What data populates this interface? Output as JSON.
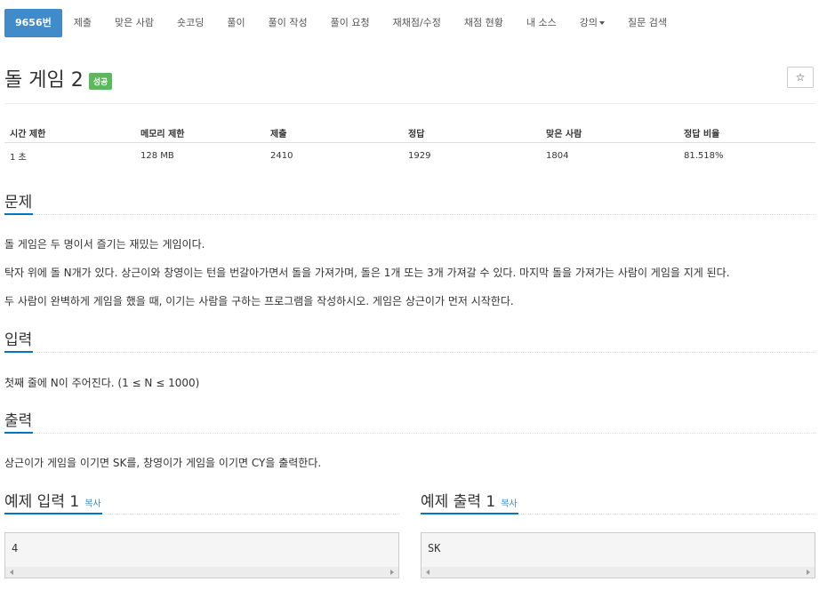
{
  "nav": {
    "items": [
      "9656번",
      "제출",
      "맞은 사람",
      "숏코딩",
      "풀이",
      "풀이 작성",
      "풀이 요청",
      "재채점/수정",
      "채점 현황",
      "내 소스",
      "강의",
      "질문 검색"
    ]
  },
  "problem": {
    "title": "돌 게임 2",
    "badge": "성공",
    "star_icon": "☆"
  },
  "info": {
    "headers": [
      "시간 제한",
      "메모리 제한",
      "제출",
      "정답",
      "맞은 사람",
      "정답 비율"
    ],
    "values": [
      "1 초",
      "128 MB",
      "2410",
      "1929",
      "1804",
      "81.518%"
    ]
  },
  "sections": {
    "problem_head": "문제",
    "problem_lines": [
      "돌 게임은 두 명이서 즐기는 재밌는 게임이다.",
      "탁자 위에 돌 N개가 있다. 상근이와 창영이는 턴을 번갈아가면서 돌을 가져가며, 돌은 1개 또는 3개 가져갈 수 있다. 마지막 돌을 가져가는 사람이 게임을 지게 된다.",
      "두 사람이 완벽하게 게임을 했을 때, 이기는 사람을 구하는 프로그램을 작성하시오. 게임은 상근이가 먼저 시작한다."
    ],
    "input_head": "입력",
    "input_text": "첫째 줄에 N이 주어진다. (1 ≤ N ≤ 1000)",
    "output_head": "출력",
    "output_text": "상근이가 게임을 이기면 SK를, 창영이가 게임을 이기면 CY을 출력한다."
  },
  "samples": {
    "input_head": "예제 입력 1",
    "output_head": "예제 출력 1",
    "copy_label": "복사",
    "input_value": "4",
    "output_value": "SK"
  },
  "colors": {
    "nav_active": "#428bca",
    "badge": "#5cb85c",
    "accent": "#0076c0",
    "link": "#428bca"
  }
}
